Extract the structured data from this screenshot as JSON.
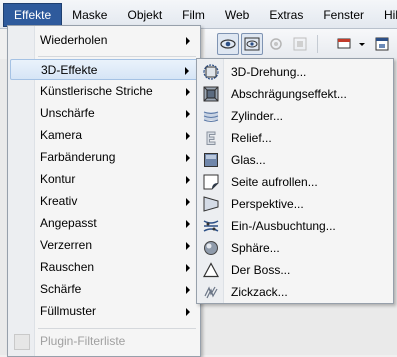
{
  "menubar": {
    "items": [
      {
        "label": "Effekte"
      },
      {
        "label": "Maske"
      },
      {
        "label": "Objekt"
      },
      {
        "label": "Film"
      },
      {
        "label": "Web"
      },
      {
        "label": "Extras"
      },
      {
        "label": "Fenster"
      },
      {
        "label": "Hilfe"
      }
    ]
  },
  "effects_menu": {
    "items": [
      {
        "label": "Wiederholen",
        "has_submenu": true
      },
      {
        "label": "3D-Effekte",
        "has_submenu": true,
        "highlighted": true
      },
      {
        "label": "Künstlerische Striche",
        "has_submenu": true
      },
      {
        "label": "Unschärfe",
        "has_submenu": true
      },
      {
        "label": "Kamera",
        "has_submenu": true
      },
      {
        "label": "Farbänderung",
        "has_submenu": true
      },
      {
        "label": "Kontur",
        "has_submenu": true
      },
      {
        "label": "Kreativ",
        "has_submenu": true
      },
      {
        "label": "Angepasst",
        "has_submenu": true
      },
      {
        "label": "Verzerren",
        "has_submenu": true
      },
      {
        "label": "Rauschen",
        "has_submenu": true
      },
      {
        "label": "Schärfe",
        "has_submenu": true
      },
      {
        "label": "Füllmuster",
        "has_submenu": true
      },
      {
        "label": "Plugin-Filterliste",
        "disabled": true
      }
    ]
  },
  "submenu_3d": {
    "items": [
      {
        "label": "3D-Drehung...",
        "icon": "3d-rotate-icon"
      },
      {
        "label": "Abschrägungseffekt...",
        "icon": "bevel-icon"
      },
      {
        "label": "Zylinder...",
        "icon": "cylinder-icon"
      },
      {
        "label": "Relief...",
        "icon": "emboss-icon"
      },
      {
        "label": "Glas...",
        "icon": "glass-icon"
      },
      {
        "label": "Seite aufrollen...",
        "icon": "page-curl-icon"
      },
      {
        "label": "Perspektive...",
        "icon": "perspective-icon"
      },
      {
        "label": "Ein-/Ausbuchtung...",
        "icon": "pinch-punch-icon"
      },
      {
        "label": "Sphäre...",
        "icon": "sphere-icon"
      },
      {
        "label": "Der Boss...",
        "icon": "the-boss-icon"
      },
      {
        "label": "Zickzack...",
        "icon": "zigzag-icon"
      }
    ]
  }
}
